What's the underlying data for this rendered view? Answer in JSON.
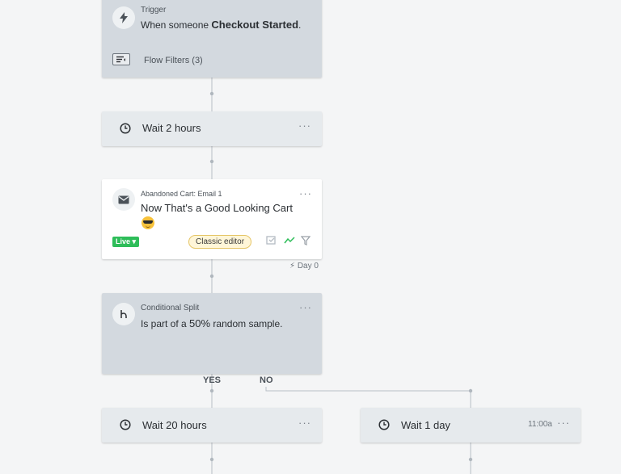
{
  "trigger": {
    "label": "Trigger",
    "prefix": "When someone",
    "event": "Checkout Started",
    "suffix": ".",
    "filters_label": "Flow Filters (3)",
    "icon": "lightning-icon"
  },
  "wait_1": {
    "label": "Wait 2 hours",
    "icon": "clock-icon",
    "more": "···"
  },
  "email": {
    "label": "Abandoned Cart: Email 1",
    "subject": "Now That's a Good Looking Cart",
    "emoji": "sunglasses-emoji",
    "status": "Live ▾",
    "editor_label": "Classic editor",
    "more": "···",
    "day_label": "Day 0",
    "colors": {
      "live": "#2ebd59",
      "editor_bg": "#fff6d8"
    }
  },
  "split": {
    "label": "Conditional Split",
    "prefix": "Is part of a",
    "percent": "50%",
    "suffix": "random sample.",
    "more": "···",
    "yes_label": "YES",
    "no_label": "NO"
  },
  "wait_yes": {
    "label": "Wait 20 hours",
    "more": "···"
  },
  "wait_no": {
    "label": "Wait 1 day",
    "time": "11:00a",
    "more": "···"
  }
}
